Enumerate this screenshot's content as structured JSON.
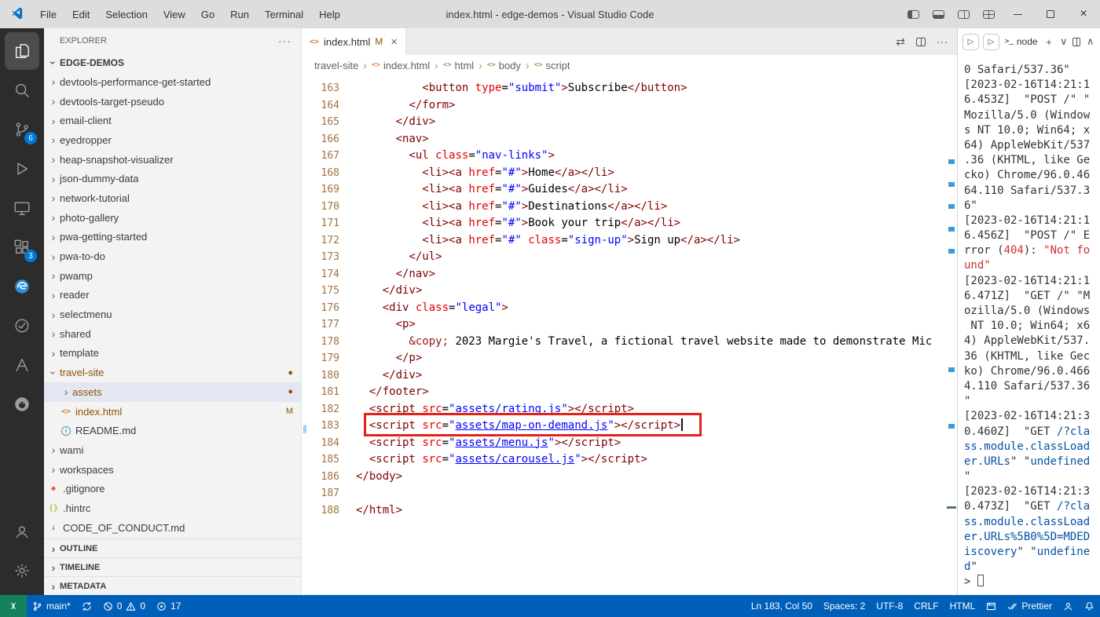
{
  "colors": {
    "statusbar": "#005fb8",
    "remote_indicator": "#16825d",
    "badge": "#0078d4",
    "annotation": "#e62117",
    "git_modified": "#895503"
  },
  "titlebar": {
    "title": "index.html - edge-demos - Visual Studio Code",
    "menus": [
      "File",
      "Edit",
      "Selection",
      "View",
      "Go",
      "Run",
      "Terminal",
      "Help"
    ]
  },
  "activity_bar": {
    "top": [
      {
        "name": "explorer",
        "active": true
      },
      {
        "name": "search"
      },
      {
        "name": "source-control",
        "badge": "6"
      },
      {
        "name": "run-and-debug"
      },
      {
        "name": "remote-explorer"
      },
      {
        "name": "extensions",
        "badge": "3"
      },
      {
        "name": "edge-devtools"
      },
      {
        "name": "circle-check"
      },
      {
        "name": "webhint"
      },
      {
        "name": "github"
      }
    ],
    "bottom": [
      {
        "name": "accounts"
      },
      {
        "name": "settings"
      }
    ]
  },
  "sidebar": {
    "title": "EXPLORER",
    "root": "EDGE-DEMOS",
    "items": [
      {
        "l": "devtools-performance-get-started",
        "k": "folder"
      },
      {
        "l": "devtools-target-pseudo",
        "k": "folder"
      },
      {
        "l": "email-client",
        "k": "folder"
      },
      {
        "l": "eyedropper",
        "k": "folder"
      },
      {
        "l": "heap-snapshot-visualizer",
        "k": "folder"
      },
      {
        "l": "json-dummy-data",
        "k": "folder"
      },
      {
        "l": "network-tutorial",
        "k": "folder"
      },
      {
        "l": "photo-gallery",
        "k": "folder"
      },
      {
        "l": "pwa-getting-started",
        "k": "folder"
      },
      {
        "l": "pwa-to-do",
        "k": "folder"
      },
      {
        "l": "pwamp",
        "k": "folder"
      },
      {
        "l": "reader",
        "k": "folder"
      },
      {
        "l": "selectmenu",
        "k": "folder"
      },
      {
        "l": "shared",
        "k": "folder"
      },
      {
        "l": "template",
        "k": "folder"
      },
      {
        "l": "travel-site",
        "k": "folder",
        "expanded": true,
        "mod": true,
        "dec": "●"
      },
      {
        "l": "assets",
        "k": "folder",
        "indent": 1,
        "selected": true,
        "mod": true,
        "dec": "●"
      },
      {
        "l": "index.html",
        "k": "file",
        "icon": "html",
        "indent": 1,
        "mod": true,
        "dec": "M"
      },
      {
        "l": "README.md",
        "k": "file",
        "icon": "info",
        "indent": 1
      },
      {
        "l": "wami",
        "k": "folder"
      },
      {
        "l": "workspaces",
        "k": "folder"
      },
      {
        "l": ".gitignore",
        "k": "file",
        "icon": "git"
      },
      {
        "l": ".hintrc",
        "k": "file",
        "icon": "json"
      },
      {
        "l": "CODE_OF_CONDUCT.md",
        "k": "file",
        "icon": "markdown"
      }
    ],
    "sections": [
      "OUTLINE",
      "TIMELINE",
      "METADATA"
    ]
  },
  "editor": {
    "tab": {
      "label": "index.html",
      "modified": "M"
    },
    "breadcrumbs": [
      "travel-site",
      "index.html",
      "html",
      "body",
      "script"
    ],
    "lines": [
      {
        "n": 163,
        "tk": [
          [
            "t",
            "          "
          ],
          [
            "p",
            "<button"
          ],
          [
            "t",
            " "
          ],
          [
            "a",
            "type"
          ],
          [
            "t",
            "="
          ],
          [
            "s",
            "\"submit\""
          ],
          [
            "p",
            ">"
          ],
          [
            "t",
            "Subscribe"
          ],
          [
            "p",
            "</button>"
          ]
        ]
      },
      {
        "n": 164,
        "tk": [
          [
            "t",
            "        "
          ],
          [
            "p",
            "</form>"
          ]
        ]
      },
      {
        "n": 165,
        "tk": [
          [
            "t",
            "      "
          ],
          [
            "p",
            "</div>"
          ]
        ]
      },
      {
        "n": 166,
        "tk": [
          [
            "t",
            "      "
          ],
          [
            "p",
            "<nav>"
          ]
        ]
      },
      {
        "n": 167,
        "tk": [
          [
            "t",
            "        "
          ],
          [
            "p",
            "<ul"
          ],
          [
            "t",
            " "
          ],
          [
            "a",
            "class"
          ],
          [
            "t",
            "="
          ],
          [
            "s",
            "\"nav-links\""
          ],
          [
            "p",
            ">"
          ]
        ]
      },
      {
        "n": 168,
        "tk": [
          [
            "t",
            "          "
          ],
          [
            "p",
            "<li><a"
          ],
          [
            "t",
            " "
          ],
          [
            "a",
            "href"
          ],
          [
            "t",
            "="
          ],
          [
            "s",
            "\"#\""
          ],
          [
            "p",
            ">"
          ],
          [
            "t",
            "Home"
          ],
          [
            "p",
            "</a></li>"
          ]
        ]
      },
      {
        "n": 169,
        "tk": [
          [
            "t",
            "          "
          ],
          [
            "p",
            "<li><a"
          ],
          [
            "t",
            " "
          ],
          [
            "a",
            "href"
          ],
          [
            "t",
            "="
          ],
          [
            "s",
            "\"#\""
          ],
          [
            "p",
            ">"
          ],
          [
            "t",
            "Guides"
          ],
          [
            "p",
            "</a></li>"
          ]
        ]
      },
      {
        "n": 170,
        "tk": [
          [
            "t",
            "          "
          ],
          [
            "p",
            "<li><a"
          ],
          [
            "t",
            " "
          ],
          [
            "a",
            "href"
          ],
          [
            "t",
            "="
          ],
          [
            "s",
            "\"#\""
          ],
          [
            "p",
            ">"
          ],
          [
            "t",
            "Destinations"
          ],
          [
            "p",
            "</a></li>"
          ]
        ]
      },
      {
        "n": 171,
        "tk": [
          [
            "t",
            "          "
          ],
          [
            "p",
            "<li><a"
          ],
          [
            "t",
            " "
          ],
          [
            "a",
            "href"
          ],
          [
            "t",
            "="
          ],
          [
            "s",
            "\"#\""
          ],
          [
            "p",
            ">"
          ],
          [
            "t",
            "Book your trip"
          ],
          [
            "p",
            "</a></li>"
          ]
        ]
      },
      {
        "n": 172,
        "tk": [
          [
            "t",
            "          "
          ],
          [
            "p",
            "<li><a"
          ],
          [
            "t",
            " "
          ],
          [
            "a",
            "href"
          ],
          [
            "t",
            "="
          ],
          [
            "s",
            "\"#\""
          ],
          [
            "t",
            " "
          ],
          [
            "a",
            "class"
          ],
          [
            "t",
            "="
          ],
          [
            "s",
            "\"sign-up\""
          ],
          [
            "p",
            ">"
          ],
          [
            "t",
            "Sign up"
          ],
          [
            "p",
            "</a></li>"
          ]
        ]
      },
      {
        "n": 173,
        "tk": [
          [
            "t",
            "        "
          ],
          [
            "p",
            "</ul>"
          ]
        ]
      },
      {
        "n": 174,
        "tk": [
          [
            "t",
            "      "
          ],
          [
            "p",
            "</nav>"
          ]
        ]
      },
      {
        "n": 175,
        "tk": [
          [
            "t",
            "    "
          ],
          [
            "p",
            "</div>"
          ]
        ]
      },
      {
        "n": 176,
        "tk": [
          [
            "t",
            "    "
          ],
          [
            "p",
            "<div"
          ],
          [
            "t",
            " "
          ],
          [
            "a",
            "class"
          ],
          [
            "t",
            "="
          ],
          [
            "s",
            "\"legal\""
          ],
          [
            "p",
            ">"
          ]
        ]
      },
      {
        "n": 177,
        "tk": [
          [
            "t",
            "      "
          ],
          [
            "p",
            "<p>"
          ]
        ]
      },
      {
        "n": 178,
        "tk": [
          [
            "t",
            "        "
          ],
          [
            "e",
            "&copy;"
          ],
          [
            "t",
            " 2023 Margie's Travel, a fictional travel website made to demonstrate Mic"
          ]
        ]
      },
      {
        "n": 179,
        "tk": [
          [
            "t",
            "      "
          ],
          [
            "p",
            "</p>"
          ]
        ]
      },
      {
        "n": 180,
        "tk": [
          [
            "t",
            "    "
          ],
          [
            "p",
            "</div>"
          ]
        ]
      },
      {
        "n": 181,
        "tk": [
          [
            "t",
            "  "
          ],
          [
            "p",
            "</footer>"
          ]
        ]
      },
      {
        "n": 182,
        "tk": [
          [
            "t",
            "  "
          ],
          [
            "p",
            "<script"
          ],
          [
            "t",
            " "
          ],
          [
            "a",
            "src"
          ],
          [
            "t",
            "="
          ],
          [
            "s",
            "\""
          ],
          [
            "l",
            "assets/rating.js"
          ],
          [
            "s",
            "\""
          ],
          [
            "p",
            "></script>"
          ]
        ]
      },
      {
        "n": 183,
        "squiggle": true,
        "caret": true,
        "tk": [
          [
            "t",
            "  "
          ],
          [
            "p",
            "<script"
          ],
          [
            "t",
            " "
          ],
          [
            "a",
            "src"
          ],
          [
            "t",
            "="
          ],
          [
            "s",
            "\""
          ],
          [
            "l",
            "assets/map-on-demand.js"
          ],
          [
            "s",
            "\""
          ],
          [
            "p",
            "></script>"
          ]
        ]
      },
      {
        "n": 184,
        "tk": [
          [
            "t",
            "  "
          ],
          [
            "p",
            "<script"
          ],
          [
            "t",
            " "
          ],
          [
            "a",
            "src"
          ],
          [
            "t",
            "="
          ],
          [
            "s",
            "\""
          ],
          [
            "l",
            "assets/menu.js"
          ],
          [
            "s",
            "\""
          ],
          [
            "p",
            "></script>"
          ]
        ]
      },
      {
        "n": 185,
        "tk": [
          [
            "t",
            "  "
          ],
          [
            "p",
            "<script"
          ],
          [
            "t",
            " "
          ],
          [
            "a",
            "src"
          ],
          [
            "t",
            "="
          ],
          [
            "s",
            "\""
          ],
          [
            "l",
            "assets/carousel.js"
          ],
          [
            "s",
            "\""
          ],
          [
            "p",
            "></script>"
          ]
        ]
      },
      {
        "n": 186,
        "tk": [
          [
            "p",
            "</body>"
          ]
        ]
      },
      {
        "n": 187,
        "tk": []
      },
      {
        "n": 188,
        "tk": [
          [
            "p",
            "</html>"
          ]
        ]
      }
    ]
  },
  "terminal": {
    "tab": "node",
    "lines": [
      {
        "s": [
          [
            "d",
            "0 Safari/537.36\""
          ]
        ]
      },
      {
        "s": [
          [
            "d",
            "[2023-02-16T14:21:1"
          ]
        ]
      },
      {
        "s": [
          [
            "d",
            "6.453Z]  \"POST /\" \""
          ]
        ]
      },
      {
        "s": [
          [
            "d",
            "Mozilla/5.0 (Window"
          ]
        ]
      },
      {
        "s": [
          [
            "d",
            "s NT 10.0; Win64; x"
          ]
        ]
      },
      {
        "s": [
          [
            "d",
            "64) AppleWebKit/537"
          ]
        ]
      },
      {
        "s": [
          [
            "d",
            ".36 (KHTML, like Ge"
          ]
        ]
      },
      {
        "s": [
          [
            "d",
            "cko) Chrome/96.0.46"
          ]
        ]
      },
      {
        "s": [
          [
            "d",
            "64.110 Safari/537.3"
          ]
        ]
      },
      {
        "s": [
          [
            "d",
            "6\""
          ]
        ]
      },
      {
        "s": [
          [
            "d",
            "[2023-02-16T14:21:1"
          ]
        ]
      },
      {
        "s": [
          [
            "d",
            "6.456Z]  \"POST /\" E"
          ]
        ]
      },
      {
        "s": [
          [
            "d",
            "rror ("
          ],
          [
            "r",
            "404"
          ],
          [
            "d",
            "): "
          ],
          [
            "r",
            "\"Not fo"
          ]
        ]
      },
      {
        "s": [
          [
            "r",
            "und\""
          ]
        ]
      },
      {
        "s": [
          [
            "d",
            "[2023-02-16T14:21:1"
          ]
        ]
      },
      {
        "s": [
          [
            "d",
            "6.471Z]  \"GET /\" \"M"
          ]
        ]
      },
      {
        "s": [
          [
            "d",
            "ozilla/5.0 (Windows"
          ]
        ]
      },
      {
        "s": [
          [
            "d",
            " NT 10.0; Win64; x6"
          ]
        ]
      },
      {
        "s": [
          [
            "d",
            "4) AppleWebKit/537."
          ]
        ]
      },
      {
        "s": [
          [
            "d",
            "36 (KHTML, like Gec"
          ]
        ]
      },
      {
        "s": [
          [
            "d",
            "ko) Chrome/96.0.466"
          ]
        ]
      },
      {
        "s": [
          [
            "d",
            "4.110 Safari/537.36"
          ]
        ]
      },
      {
        "s": [
          [
            "d",
            "\""
          ]
        ]
      },
      {
        "s": [
          [
            "d",
            "[2023-02-16T14:21:3"
          ]
        ]
      },
      {
        "s": [
          [
            "d",
            "0.460Z]  \"GET "
          ],
          [
            "b",
            "/?cla"
          ]
        ]
      },
      {
        "s": [
          [
            "b",
            "ss.module.classLoad"
          ]
        ]
      },
      {
        "s": [
          [
            "b",
            "er.URLs"
          ],
          [
            "d",
            "\" \""
          ],
          [
            "b",
            "undefined"
          ]
        ]
      },
      {
        "s": [
          [
            "d",
            "\""
          ]
        ]
      },
      {
        "s": [
          [
            "d",
            "[2023-02-16T14:21:3"
          ]
        ]
      },
      {
        "s": [
          [
            "d",
            "0.473Z]  \"GET "
          ],
          [
            "b",
            "/?cla"
          ]
        ]
      },
      {
        "s": [
          [
            "b",
            "ss.module.classLoad"
          ]
        ]
      },
      {
        "s": [
          [
            "b",
            "er.URLs%5B0%5D=MDED"
          ]
        ]
      },
      {
        "s": [
          [
            "b",
            "iscovery"
          ],
          [
            "d",
            "\" \""
          ],
          [
            "b",
            "undefine"
          ]
        ]
      },
      {
        "s": [
          [
            "b",
            "d"
          ],
          [
            "d",
            "\""
          ]
        ]
      },
      {
        "s": [
          [
            "d",
            "> "
          ]
        ],
        "cursor": true
      }
    ]
  },
  "status_bar": {
    "branch": "main*",
    "errors": "0",
    "warnings": "0",
    "hints": "17",
    "position": "Ln 183, Col 50",
    "spaces": "Spaces: 2",
    "encoding": "UTF-8",
    "eol": "CRLF",
    "language": "HTML",
    "formatter": "Prettier"
  }
}
